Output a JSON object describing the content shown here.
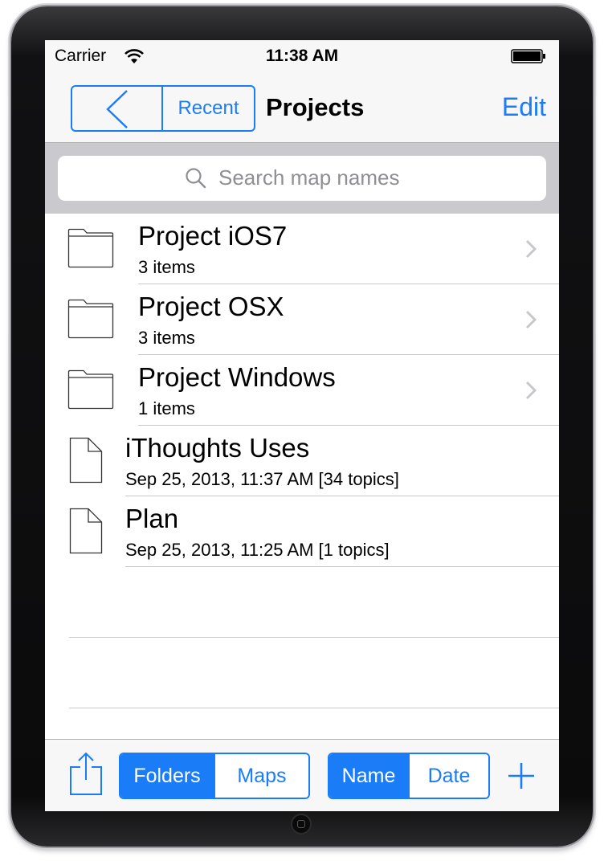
{
  "status_bar": {
    "carrier": "Carrier",
    "time": "11:38 AM"
  },
  "nav": {
    "back_icon": "chevron-left-icon",
    "recent_label": "Recent",
    "title": "Projects",
    "edit_label": "Edit"
  },
  "search": {
    "placeholder": "Search map names"
  },
  "folders": [
    {
      "title": "Project iOS7",
      "subtitle": "3 items"
    },
    {
      "title": "Project OSX",
      "subtitle": "3 items"
    },
    {
      "title": "Project Windows",
      "subtitle": "1 items"
    }
  ],
  "maps": [
    {
      "title": "iThoughts Uses",
      "subtitle": "Sep 25, 2013, 11:37 AM [34 topics]"
    },
    {
      "title": "Plan",
      "subtitle": "Sep 25, 2013, 11:25 AM [1 topics]"
    }
  ],
  "toolbar": {
    "share_icon": "share-icon",
    "view_segment": {
      "options": [
        "Folders",
        "Maps"
      ],
      "selected": "Folders"
    },
    "sort_segment": {
      "options": [
        "Name",
        "Date"
      ],
      "selected": "Name"
    },
    "add_icon": "plus-icon"
  },
  "colors": {
    "accent": "#1a7df7",
    "bar_background": "#f7f7f7",
    "search_background": "#c9c9ce",
    "separator": "#c8c7cc"
  }
}
